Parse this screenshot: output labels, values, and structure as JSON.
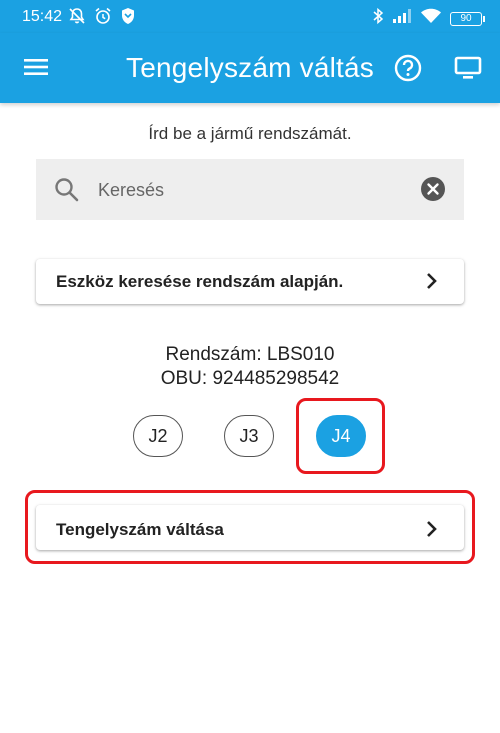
{
  "status_bar": {
    "time": "15:42",
    "battery": "90",
    "left_icons": [
      "mute-bell-icon",
      "alarm-icon",
      "shield-icon"
    ],
    "right_icons": [
      "bluetooth-icon",
      "signal-icon",
      "wifi-icon",
      "battery-icon"
    ]
  },
  "app_bar": {
    "title": "Tengelyszám váltás",
    "background": "#1ba1e2",
    "icons": [
      "menu-icon",
      "help-icon",
      "monitor-icon"
    ]
  },
  "prompt": "Írd be a jármű rendszámát.",
  "search": {
    "placeholder": "Keresés",
    "value": ""
  },
  "search_by_plate": {
    "label": "Eszköz keresése rendszám alapján."
  },
  "vehicle": {
    "plate_line": "Rendszám: LBS010",
    "obu_line": "OBU: 924485298542"
  },
  "axle_options": [
    {
      "label": "J2",
      "selected": false
    },
    {
      "label": "J3",
      "selected": false
    },
    {
      "label": "J4",
      "selected": true
    }
  ],
  "change_axle": {
    "label": "Tengelyszám váltása"
  },
  "colors": {
    "accent": "#1ba1e2",
    "highlight": "#e8181e"
  }
}
